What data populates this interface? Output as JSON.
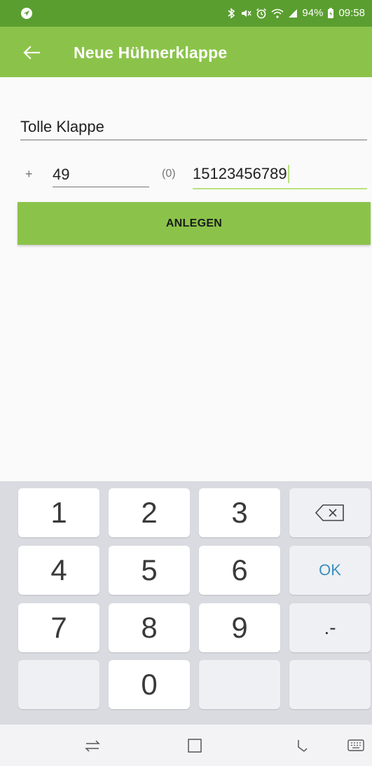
{
  "status_bar": {
    "battery": "94%",
    "time": "09:58"
  },
  "app_bar": {
    "title": "Neue Hühnerklappe"
  },
  "form": {
    "name_value": "Tolle Klappe",
    "plus_sign": "+",
    "country_code": "49",
    "zero_prefix": "(0)",
    "phone_number": "15123456789",
    "submit_label": "ANLEGEN"
  },
  "keyboard": {
    "keys": [
      "1",
      "2",
      "3",
      "4",
      "5",
      "6",
      "7",
      "8",
      "9",
      "0"
    ],
    "ok_label": "OK",
    "symbol_label": ".-"
  },
  "colors": {
    "status_bar": "#5a9e2f",
    "app_bar": "#8bc34a",
    "accent": "#8bc34a",
    "ok_text": "#3b8fbf"
  },
  "icons": {
    "status_left": "navigation-icon",
    "back": "back-arrow-icon",
    "backspace": "backspace-icon",
    "nav_recents": "recents-icon",
    "nav_home": "home-icon",
    "nav_back": "back-icon",
    "nav_keyboard": "keyboard-icon"
  }
}
